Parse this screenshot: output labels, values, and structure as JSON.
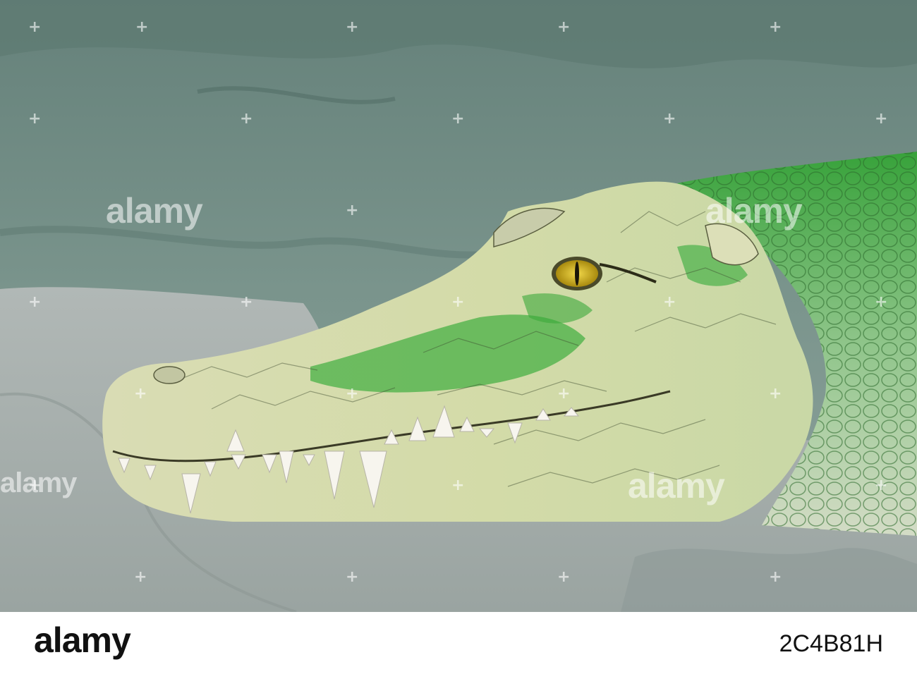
{
  "watermark": {
    "text": "alamy"
  },
  "footer": {
    "logo_text": "alamy",
    "image_id": "2C4B81H"
  },
  "colors": {
    "background_rock": "#6f8a80",
    "ground": "#a9b0ae",
    "skin_pale": "#d6dbb0",
    "skin_green": "#3fae3f",
    "eye": "#d8b41a",
    "teeth": "#f7f5ee"
  }
}
